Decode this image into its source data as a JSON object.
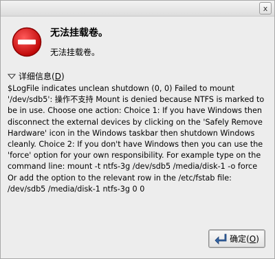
{
  "window": {
    "close_label": "x"
  },
  "dialog": {
    "title": "无法挂载卷。",
    "subtitle": "无法挂载卷。",
    "details_label_prefix": "详细信息(",
    "details_label_key": "D",
    "details_label_suffix": ")",
    "details_text": "$LogFile indicates unclean shutdown (0, 0) Failed to mount '/dev/sdb5': 操作不支持 Mount is denied because NTFS is marked to be in use. Choose one action: Choice 1: If you have Windows then disconnect the external devices by clicking on the 'Safely Remove Hardware' icon in the Windows taskbar then shutdown Windows cleanly. Choice 2: If you don't have Windows then you can use the 'force' option for your own responsibility. For example type on the command line: mount -t ntfs-3g /dev/sdb5 /media/disk-1 -o force Or add the option to the relevant row in the /etc/fstab file: /dev/sdb5 /media/disk-1 ntfs-3g 0 0"
  },
  "buttons": {
    "ok_prefix": "确定(",
    "ok_key": "O",
    "ok_suffix": ")"
  },
  "colors": {
    "stop_icon_red": "#d40000",
    "ok_arrow_blue": "#3465a4"
  }
}
